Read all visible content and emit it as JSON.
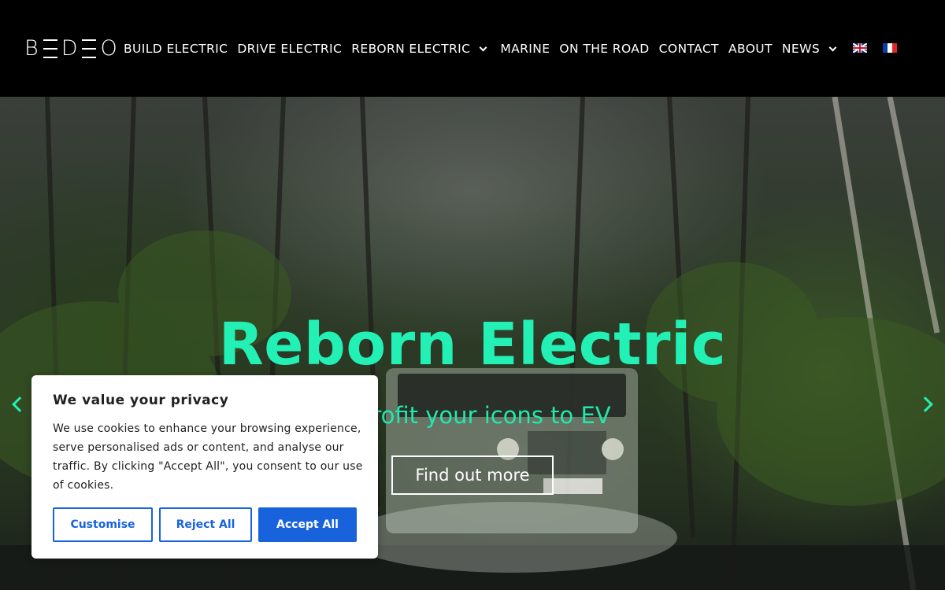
{
  "header": {
    "logo_letters": [
      "B",
      "D",
      "O"
    ],
    "nav": [
      {
        "label": "BUILD ELECTRIC",
        "has_dropdown": false
      },
      {
        "label": "DRIVE ELECTRIC",
        "has_dropdown": false
      },
      {
        "label": "REBORN ELECTRIC",
        "has_dropdown": true
      },
      {
        "label": "MARINE",
        "has_dropdown": false
      },
      {
        "label": "ON THE ROAD",
        "has_dropdown": false
      },
      {
        "label": "CONTACT",
        "has_dropdown": false
      },
      {
        "label": "ABOUT",
        "has_dropdown": false
      },
      {
        "label": "NEWS",
        "has_dropdown": true
      }
    ],
    "languages": [
      {
        "code": "en",
        "icon": "uk-flag-icon"
      },
      {
        "code": "fr",
        "icon": "france-flag-icon",
        "colors": [
          "#0b3fa8",
          "#ffffff",
          "#e1262b"
        ]
      }
    ]
  },
  "hero": {
    "title": "Reborn Electric",
    "subtitle": "Retrofit your icons to EV",
    "button": "Find out more",
    "accent": "#22f0b4",
    "prev_icon": "chevron-left-icon",
    "next_icon": "chevron-right-icon"
  },
  "cookie": {
    "title": "We value your privacy",
    "text": "We use cookies to enhance your browsing experience, serve personalised ads or content, and analyse our traffic. By clicking \"Accept All\", you consent to our use of cookies.",
    "customise": "Customise",
    "reject": "Reject All",
    "accept": "Accept All",
    "button_color": "#1863dc"
  }
}
